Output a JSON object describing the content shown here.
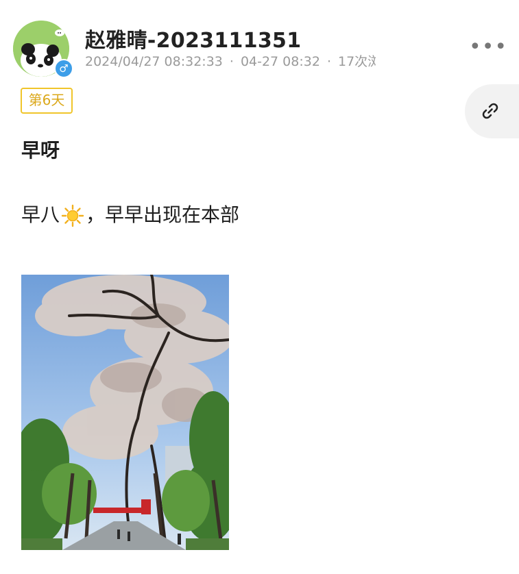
{
  "post": {
    "author": "赵雅晴-2023111351",
    "timestamp": "2024/04/27 08:32:33",
    "short_time": "04-27 08:32",
    "views": "17次浏",
    "separator": "·",
    "day_tag": "第6天",
    "title": "早呀",
    "body_before": "早八",
    "body_after": "，早早出现在本部",
    "more_label": "•••"
  },
  "colors": {
    "tag_border": "#f0c52a",
    "tag_text": "#dba81a",
    "badge_blue": "#3d9ee8",
    "avatar_green": "#9ccf6a"
  },
  "icons": {
    "gender": "male-symbol-icon",
    "link": "link-icon",
    "more": "more-dots-icon",
    "sun": "sun-emoji-icon"
  },
  "badge_symbol": "♂"
}
